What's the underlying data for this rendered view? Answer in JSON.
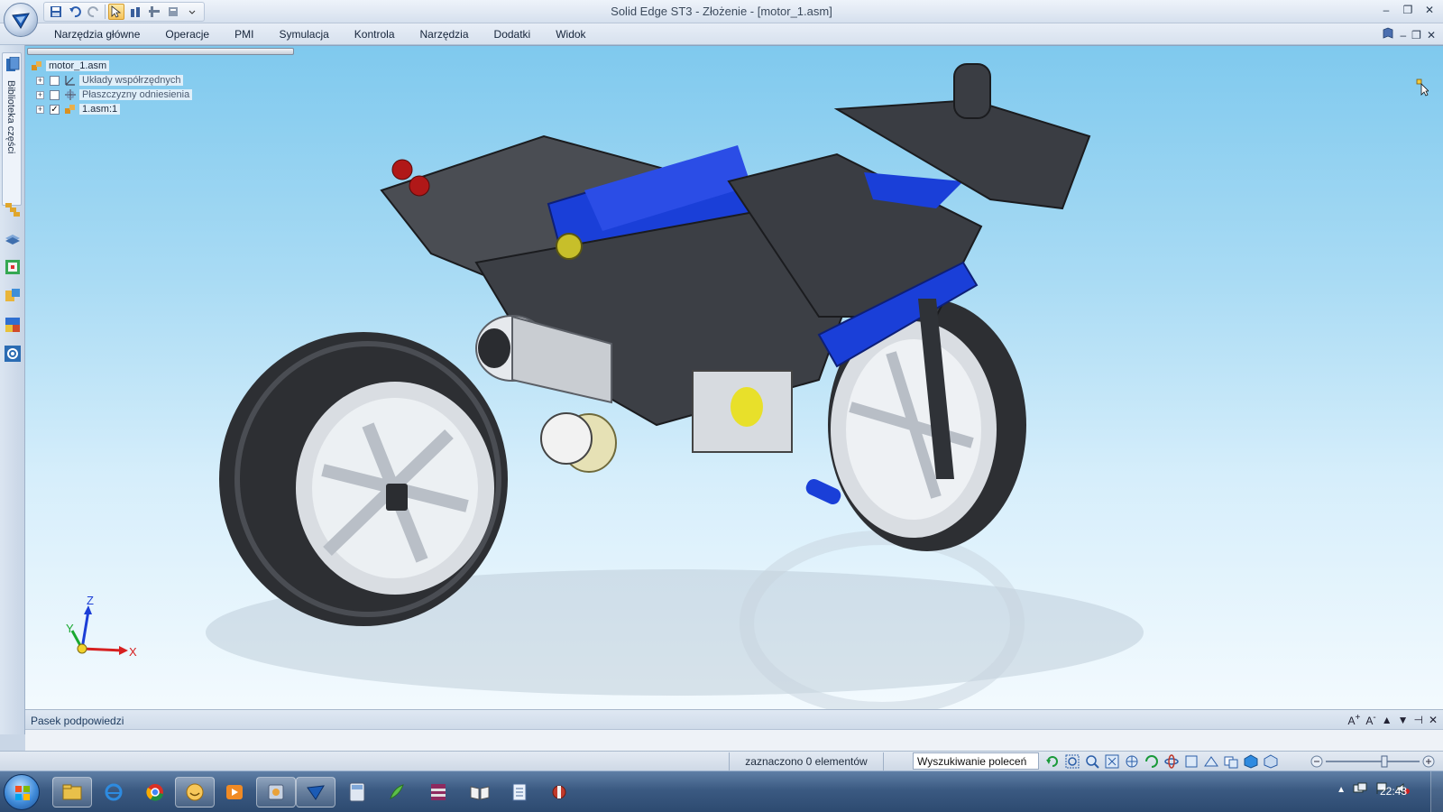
{
  "window": {
    "title": "Solid Edge ST3 - Złożenie - [motor_1.asm]",
    "controls": {
      "minimize": "–",
      "restore": "❐",
      "close": "✕"
    }
  },
  "menu": {
    "items": [
      "Narzędzia główne",
      "Operacje",
      "PMI",
      "Symulacja",
      "Kontrola",
      "Narzędzia",
      "Dodatki",
      "Widok"
    ],
    "doc_controls": {
      "minimize": "–",
      "restore": "❐",
      "close": "✕"
    }
  },
  "left_strip": {
    "library_label": "Biblioteka części"
  },
  "tree": {
    "root": "motor_1.asm",
    "children": [
      {
        "label": "Układy współrzędnych",
        "checked": false
      },
      {
        "label": "Płaszczyzny odniesienia",
        "checked": false
      },
      {
        "label": "1.asm:1",
        "checked": true
      }
    ]
  },
  "triad": {
    "x": "X",
    "y": "Y",
    "z": "Z"
  },
  "hint": {
    "title": "Pasek podpowiedzi",
    "content": ""
  },
  "status": {
    "selection": "zaznaczono 0 elementów",
    "search_value": "Wyszukiwanie poleceń"
  },
  "taskbar": {
    "time": "22:43"
  },
  "colors": {
    "viewport_top": "#7fc9ee",
    "viewport_bottom": "#f3fafe",
    "model_blue": "#1a3fd8",
    "model_dark": "#3c3f45"
  },
  "icons": {
    "qat": [
      "save-icon",
      "undo-icon",
      "redo-icon",
      "select-icon",
      "part-icon",
      "assembly-icon",
      "properties-icon"
    ],
    "side": [
      "library-icon",
      "assembly-tree-icon",
      "layers-icon",
      "sensors-icon",
      "select-tools-icon",
      "render-icon",
      "settings-icon"
    ],
    "view_tools": [
      "refresh-icon",
      "zoom-area-icon",
      "zoom-icon",
      "fit-icon",
      "pan-icon",
      "rotate-icon",
      "spin-icon",
      "view-orient-icon",
      "sketch-view-icon",
      "named-views-icon",
      "cube-icon",
      "shaded-icon"
    ],
    "taskbar": [
      "explorer-icon",
      "ie-icon",
      "chrome-icon",
      "messenger-icon",
      "media-icon",
      "settings-app-icon",
      "solidedge-icon",
      "calc-icon",
      "feather-icon",
      "winrar-icon",
      "reader-icon",
      "notepad-icon",
      "tool-icon"
    ]
  }
}
